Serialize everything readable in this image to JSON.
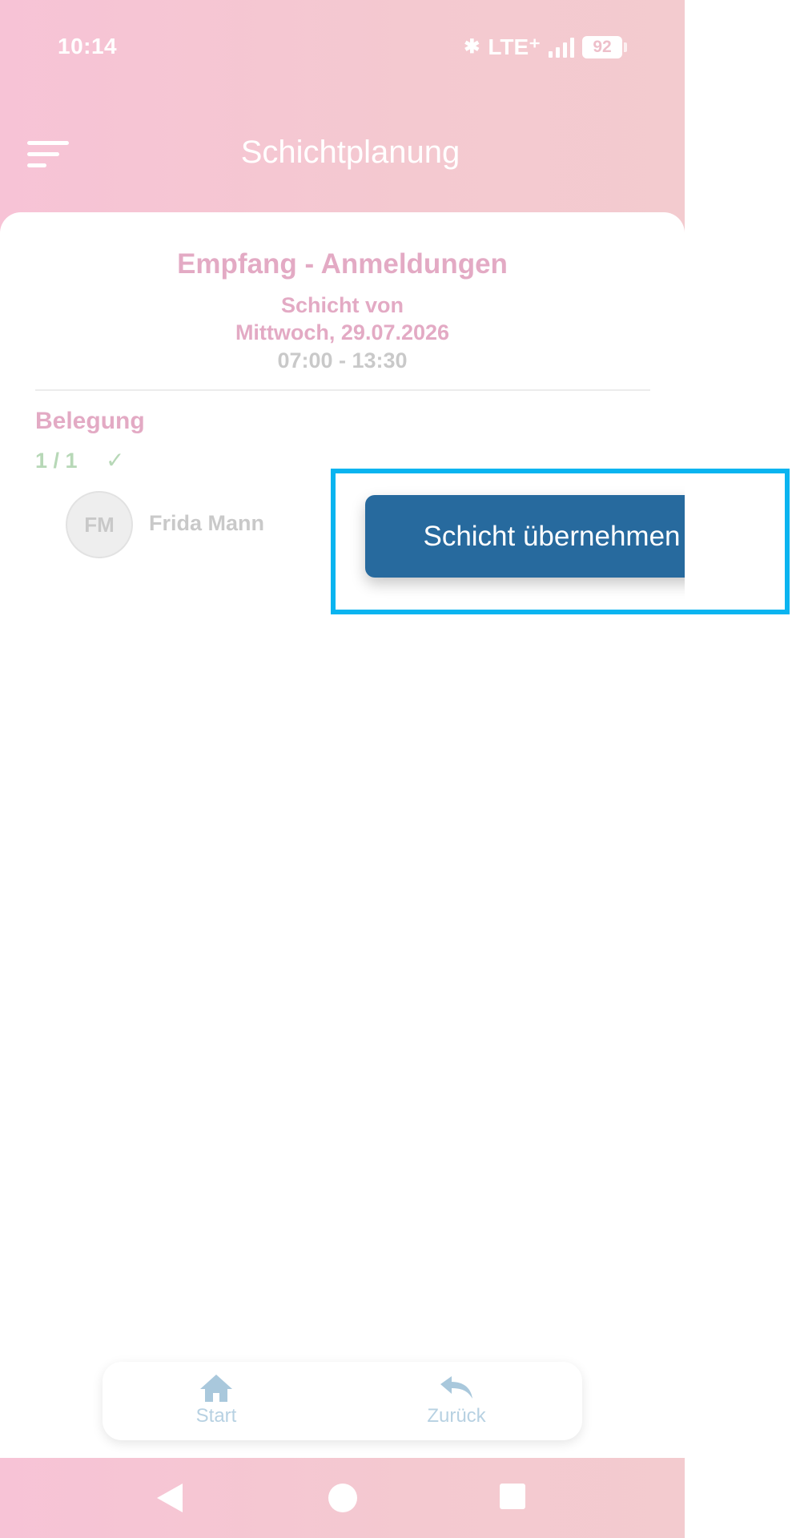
{
  "status_bar": {
    "time": "10:14",
    "network": "LTE⁺",
    "battery": "92"
  },
  "app_bar": {
    "title": "Schichtplanung"
  },
  "shift": {
    "title": "Empfang - Anmeldungen",
    "from_label": "Schicht von",
    "date": "Mittwoch, 29.07.2026",
    "time_range": "07:00 - 13:30"
  },
  "occupancy": {
    "label": "Belegung",
    "count": "1 / 1",
    "members": [
      {
        "initials": "FM",
        "name": "Frida Mann"
      }
    ]
  },
  "action": {
    "take_shift_label": "Schicht übernehmen"
  },
  "bottom_nav": {
    "start_label": "Start",
    "back_label": "Zurück"
  },
  "colors": {
    "header_pink": "#f7c3d6",
    "title_pink": "#e3aac4",
    "primary_button": "#276a9e",
    "highlight": "#0ab4f0",
    "occupancy_green": "#b7d8b7",
    "nav_icon": "#a9c8dc"
  }
}
